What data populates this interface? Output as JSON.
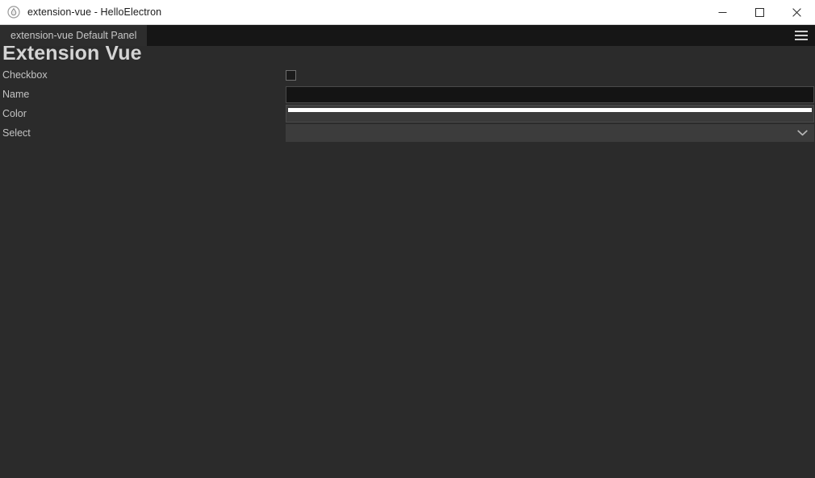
{
  "window": {
    "title": "extension-vue - HelloElectron",
    "app_icon": "electron-droplet-icon",
    "controls": {
      "minimize_label": "Minimize",
      "maximize_label": "Maximize",
      "close_label": "Close"
    }
  },
  "tabbar": {
    "tabs": [
      {
        "label": "extension-vue Default Panel",
        "active": true
      }
    ],
    "menu_icon": "hamburger-menu-icon"
  },
  "panel": {
    "title": "Extension Vue",
    "fields": [
      {
        "label": "Checkbox",
        "type": "checkbox",
        "checked": false,
        "value": ""
      },
      {
        "label": "Name",
        "type": "text",
        "value": "",
        "placeholder": ""
      },
      {
        "label": "Color",
        "type": "color",
        "value": "#ffffff"
      },
      {
        "label": "Select",
        "type": "select",
        "value": "",
        "chevron_icon": "chevron-down-icon"
      }
    ]
  },
  "colors": {
    "titlebar_bg": "#ffffff",
    "tabbar_bg": "#161616",
    "active_tab_bg": "#2d2d2d",
    "content_bg": "#2b2b2b",
    "label_text": "#c3c3c3",
    "heading_text": "#d4d4d4",
    "input_bg": "#141414",
    "select_bg": "#3c3c3c",
    "color_swatch": "#ffffff"
  }
}
